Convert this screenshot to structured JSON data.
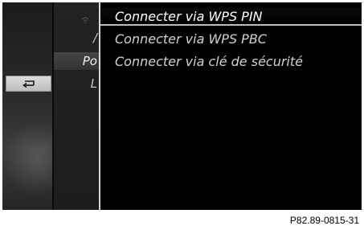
{
  "left_panel": {
    "back_icon": "back-arrow-icon"
  },
  "middle_panel": {
    "icon": "wifi-icon",
    "items": [
      {
        "label": "/"
      },
      {
        "label": "Po"
      },
      {
        "label": "L"
      }
    ]
  },
  "menu": {
    "items": [
      {
        "label": "Connecter via WPS PIN",
        "selected": true
      },
      {
        "label": "Connecter via WPS PBC",
        "selected": false
      },
      {
        "label": "Connecter via clé de sécurité",
        "selected": false
      }
    ]
  },
  "footer": {
    "reference_code": "P82.89-0815-31"
  },
  "colors": {
    "screen_background": "#000000",
    "text_normal": "#d2d2d2",
    "text_selected": "#ffffff",
    "button_background": "#cfcfcf"
  }
}
